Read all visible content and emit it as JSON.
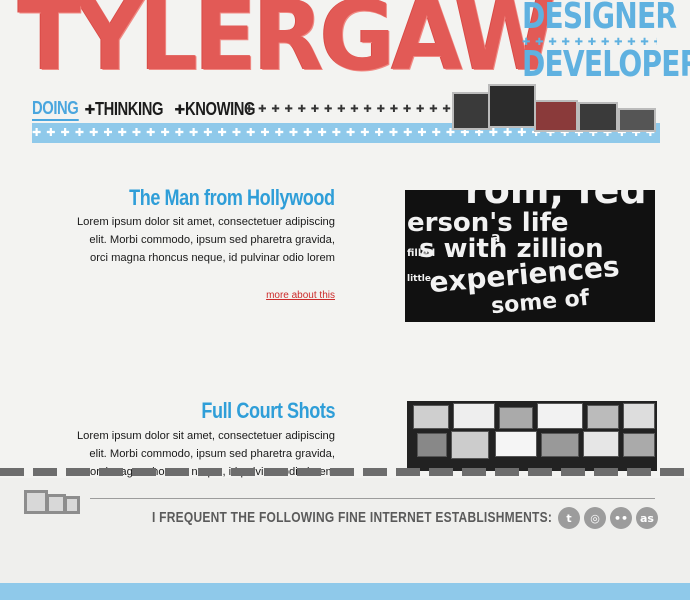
{
  "header": {
    "logo": "TYLERGAW",
    "tagline": {
      "line1": "DESIGNER",
      "line2": "DEVELOPER"
    },
    "nav": [
      {
        "label": "DOING",
        "active": true
      },
      {
        "label": "THINKING",
        "active": false
      },
      {
        "label": "KNOWING",
        "active": false
      }
    ],
    "ornament": "✚ ✚ ✚ ✚ ✚ ✚ ✚ ✚ ✚ ✚ ✚ ✚ ✚ ✚ ✚ ✚ ✚ ✚ ✚ ✚ ✚ ✚ ✚ ✚ ✚ ✚ ✚ ✚ ✚ ✚ ✚ ✚ ✚ ✚ ✚ ✚ ✚ ✚ ✚ ✚ ✚ ✚ ✚ ✚ ✚ ✚"
  },
  "articles": [
    {
      "title": "The Man from Hollywood",
      "body": "Lorem ipsum dolor sit amet, consectetuer adipiscing elit. Morbi commodo, ipsum sed pharetra gravida, orci magna rhoncus neque, id pulvinar odio lorem",
      "more": "more about this",
      "thumb_lines": [
        "rom, fed",
        "erson's life",
        "a",
        "filled",
        "s with zillion",
        "little",
        "experiences",
        "some of"
      ]
    },
    {
      "title": "Full Court Shots",
      "body": "Lorem ipsum dolor sit amet, consectetuer adipiscing elit. Morbi commodo, ipsum sed pharetra gravida, orci magna rhoncus neque, id pulvinar odio lorem"
    }
  ],
  "footer": {
    "text": "I FREQUENT THE FOLLOWING FINE INTERNET ESTABLISHMENTS:",
    "social": [
      {
        "icon": "twitter-icon",
        "glyph": "t"
      },
      {
        "icon": "dribbble-icon",
        "glyph": "◎"
      },
      {
        "icon": "flickr-icon",
        "glyph": "••"
      },
      {
        "icon": "lastfm-icon",
        "glyph": "as"
      }
    ]
  },
  "colors": {
    "logo_red": "#e25a56",
    "accent_blue": "#2f9ed8",
    "band_blue": "#8fc9ea",
    "link_red": "#cc2b2b"
  }
}
